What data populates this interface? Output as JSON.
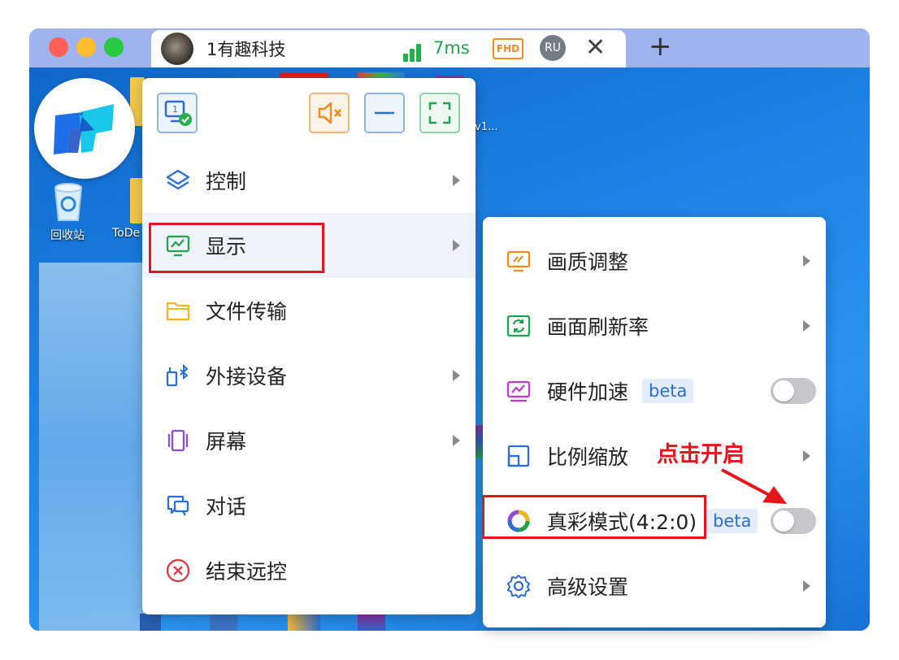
{
  "window": {
    "traffic_colors": [
      "#fe5f57",
      "#febc2e",
      "#28c840"
    ]
  },
  "tab": {
    "title": "1有趣科技",
    "latency": "7ms",
    "quality": "FHD",
    "user_initials": "RU",
    "close_symbol": "✕",
    "new_tab_symbol": "+"
  },
  "desktop": {
    "icons": [
      {
        "label": "回收站"
      },
      {
        "label": "ToDe"
      },
      {
        "label": "v1..."
      }
    ]
  },
  "toolbar": {
    "monitor_number": "1",
    "icons": [
      "monitor-check-icon",
      "mute-icon",
      "minimize-icon",
      "fullscreen-icon"
    ]
  },
  "main_menu": {
    "items": [
      {
        "label": "控制",
        "icon": "layers-icon",
        "has_submenu": true
      },
      {
        "label": "显示",
        "icon": "display-icon",
        "has_submenu": true,
        "highlighted": true
      },
      {
        "label": "文件传输",
        "icon": "folder-icon",
        "has_submenu": false
      },
      {
        "label": "外接设备",
        "icon": "bluetooth-device-icon",
        "has_submenu": true
      },
      {
        "label": "屏幕",
        "icon": "screens-icon",
        "has_submenu": true
      },
      {
        "label": "对话",
        "icon": "chat-icon",
        "has_submenu": false
      },
      {
        "label": "结束远控",
        "icon": "close-circle-icon",
        "has_submenu": false
      }
    ]
  },
  "display_submenu": {
    "items": [
      {
        "label": "画质调整",
        "icon": "quality-icon",
        "has_submenu": true
      },
      {
        "label": "画面刷新率",
        "icon": "refresh-icon",
        "has_submenu": true
      },
      {
        "label": "硬件加速",
        "icon": "hardware-icon",
        "badge": "beta",
        "toggle": false
      },
      {
        "label": "比例缩放",
        "icon": "scale-icon",
        "has_submenu": true
      },
      {
        "label": "真彩模式(4:2:0)",
        "icon": "color-wheel-icon",
        "badge": "beta",
        "toggle": false
      },
      {
        "label": "高级设置",
        "icon": "settings-icon",
        "has_submenu": true
      }
    ]
  },
  "annotation": {
    "text": "点击开启"
  },
  "colors": {
    "highlight_red": "#e8141c",
    "accent_blue": "#2b6fd6",
    "signal_green": "#22b14c",
    "fhd_orange": "#f08c1e"
  }
}
